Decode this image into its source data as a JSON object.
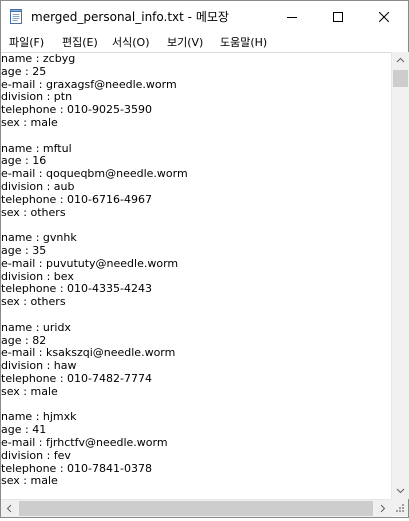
{
  "window": {
    "title": "merged_personal_info.txt - 메모장"
  },
  "menu": [
    {
      "label": "파일(F)"
    },
    {
      "label": "편집(E)"
    },
    {
      "label": "서식(O)"
    },
    {
      "label": "보기(V)"
    },
    {
      "label": "도움말(H)"
    }
  ],
  "editor": {
    "lines": [
      "name : zcbyg",
      "age : 25",
      "e-mail : graxagsf@needle.worm",
      "division : ptn",
      "telephone : 010-9025-3590",
      "sex : male",
      "",
      "name : mftul",
      "age : 16",
      "e-mail : qoqueqbm@needle.worm",
      "division : aub",
      "telephone : 010-6716-4967",
      "sex : others",
      "",
      "name : gvnhk",
      "age : 35",
      "e-mail : puvututy@needle.worm",
      "division : bex",
      "telephone : 010-4335-4243",
      "sex : others",
      "",
      "name : uridx",
      "age : 82",
      "e-mail : ksakszqi@needle.worm",
      "division : haw",
      "telephone : 010-7482-7774",
      "sex : male",
      "",
      "name : hjmxk",
      "age : 41",
      "e-mail : fjrhctfv@needle.worm",
      "division : fev",
      "telephone : 010-7841-0378",
      "sex : male"
    ]
  },
  "icons": {
    "app": "notepad-icon",
    "minimize": "minimize-icon",
    "maximize": "maximize-icon",
    "close": "close-icon"
  }
}
